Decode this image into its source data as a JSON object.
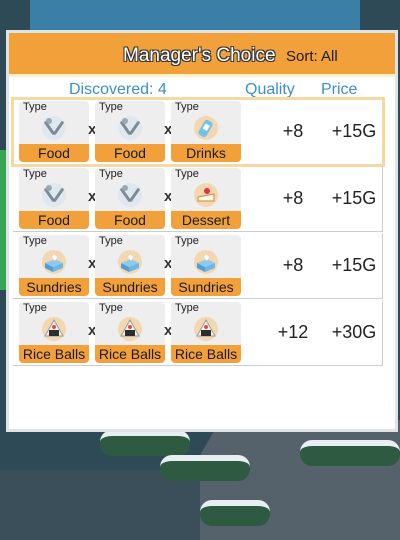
{
  "panel": {
    "title": "Manager's Choice",
    "sort_label": "Sort: All",
    "discovered_label": "Discovered: 4",
    "quality_header": "Quality",
    "price_header": "Price"
  },
  "combo_separator": "x",
  "rows": [
    {
      "selected": true,
      "slots": [
        {
          "type_label": "Type",
          "name": "Food",
          "icon": "fork-spoon-icon"
        },
        {
          "type_label": "Type",
          "name": "Food",
          "icon": "fork-spoon-icon"
        },
        {
          "type_label": "Type",
          "name": "Drinks",
          "icon": "drink-icon"
        }
      ],
      "quality": "+8",
      "price": "+15G"
    },
    {
      "selected": false,
      "slots": [
        {
          "type_label": "Type",
          "name": "Food",
          "icon": "fork-spoon-icon"
        },
        {
          "type_label": "Type",
          "name": "Food",
          "icon": "fork-spoon-icon"
        },
        {
          "type_label": "Type",
          "name": "Dessert",
          "icon": "cake-icon"
        }
      ],
      "quality": "+8",
      "price": "+15G"
    },
    {
      "selected": false,
      "slots": [
        {
          "type_label": "Type",
          "name": "Sundries",
          "icon": "tissue-box-icon"
        },
        {
          "type_label": "Type",
          "name": "Sundries",
          "icon": "tissue-box-icon"
        },
        {
          "type_label": "Type",
          "name": "Sundries",
          "icon": "tissue-box-icon"
        }
      ],
      "quality": "+8",
      "price": "+15G"
    },
    {
      "selected": false,
      "slots": [
        {
          "type_label": "Type",
          "name": "Rice Balls",
          "icon": "rice-ball-icon"
        },
        {
          "type_label": "Type",
          "name": "Rice Balls",
          "icon": "rice-ball-icon"
        },
        {
          "type_label": "Type",
          "name": "Rice Balls",
          "icon": "rice-ball-icon"
        }
      ],
      "quality": "+12",
      "price": "+30G"
    }
  ],
  "colors": {
    "accent_orange": "#f2a13a",
    "header_blue_text": "#3d8fc7",
    "slot_bg": "#eeeeee"
  }
}
